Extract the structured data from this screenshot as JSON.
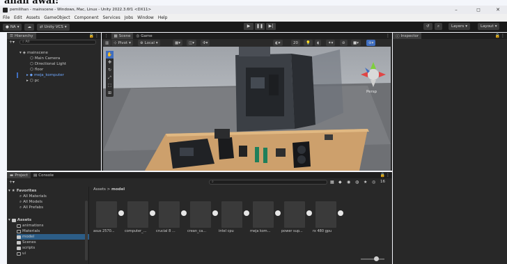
{
  "clipped_heading": "anan awal:",
  "window": {
    "title": "pemilihan - mainscene - Windows, Mac, Linux - Unity 2022.3.6f1 <DX11>",
    "minimize": "–",
    "maximize": "◻"
  },
  "menu": [
    "File",
    "Edit",
    "Assets",
    "GameObject",
    "Component",
    "Services",
    "Jobs",
    "Window",
    "Help"
  ],
  "toolbar": {
    "account": "NA",
    "vcs": "Unity VCS",
    "layers": "Layers",
    "layout": "Layout"
  },
  "hierarchy": {
    "tab": "Hierarchy",
    "search_placeholder": "All",
    "scene_name": "mainscene",
    "items": [
      "Main Camera",
      "Directional Light",
      "floor",
      "meja_komputer",
      "pc"
    ]
  },
  "scene_view": {
    "tabs": [
      "Scene",
      "Game"
    ],
    "pivot": "Pivot",
    "local": "Local",
    "gizmo_count": "20",
    "persp_label": "Persp"
  },
  "inspector": {
    "tab": "Inspector"
  },
  "project": {
    "tabs": [
      "Project",
      "Console"
    ],
    "breadcrumb": [
      "Assets",
      "model"
    ],
    "favorites_label": "Favorites",
    "favorites": [
      "All Materials",
      "All Models",
      "All Prefabs"
    ],
    "assets_label": "Assets",
    "folders": [
      "animations",
      "Materials",
      "model",
      "Scenes",
      "scripts",
      "ui"
    ],
    "asset_items": [
      "asus 2570...",
      "computer_...",
      "crucial 8 ...",
      "crean_ca...",
      "intel cpu",
      "meja kom...",
      "power sup...",
      "rx 480 gpu"
    ],
    "count_badge": "16"
  },
  "colors": {
    "editor_dark": "#282828",
    "toolbar": "#191919",
    "accent_blue": "#3f6ec0",
    "desk": "#cda06c"
  }
}
